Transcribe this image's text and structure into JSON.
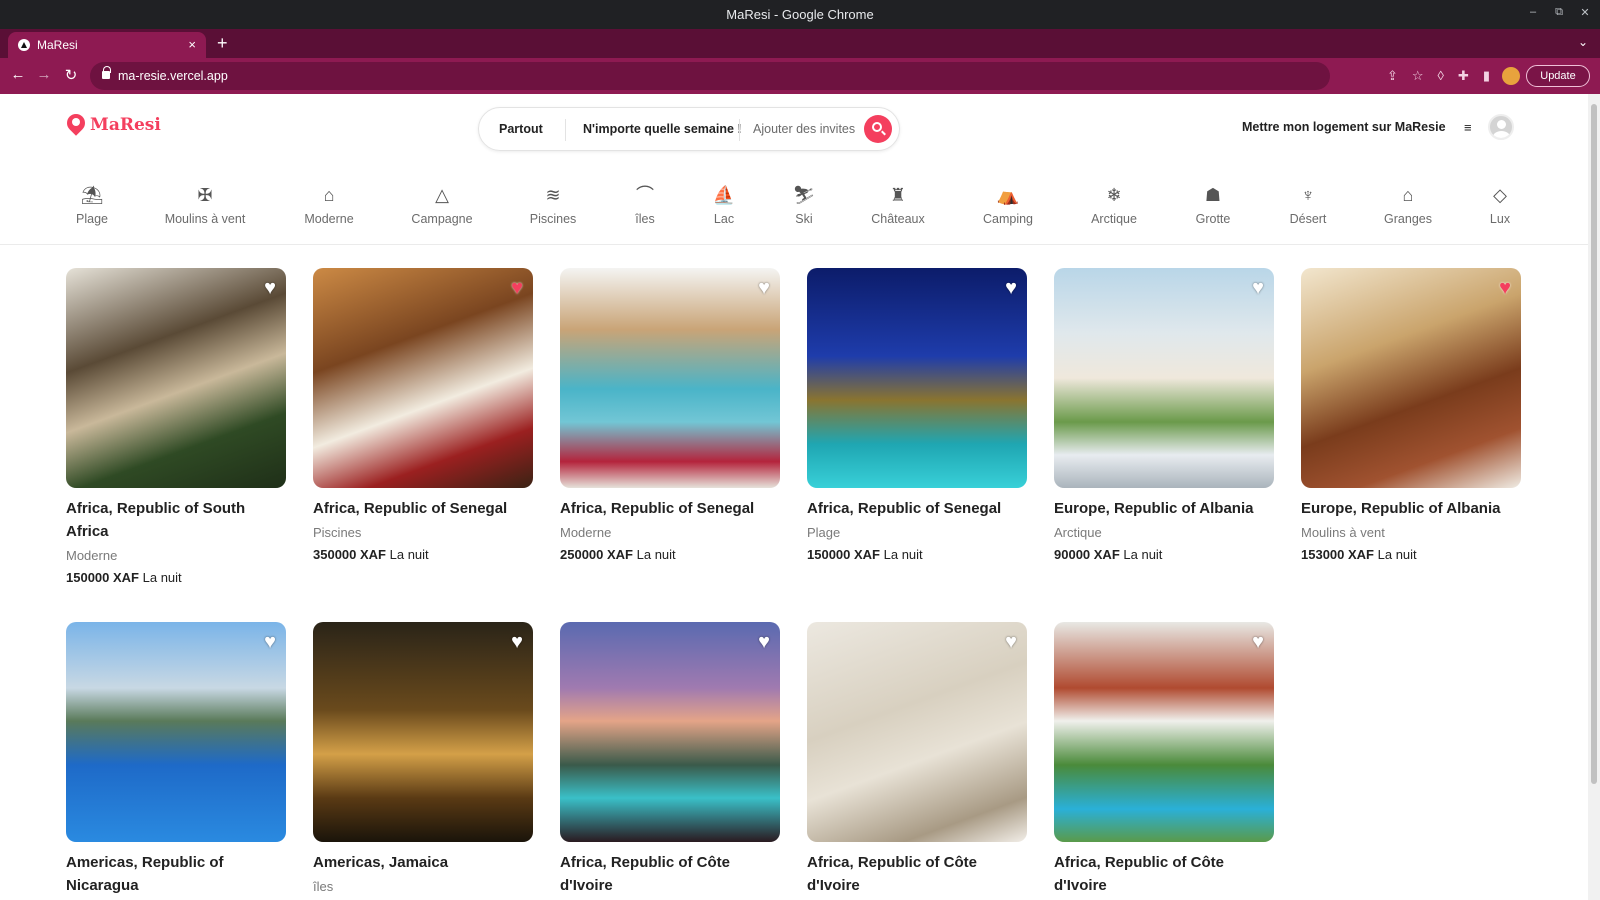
{
  "window": {
    "title": "MaResi - Google Chrome",
    "controls": [
      "–",
      "⧉",
      "✕"
    ]
  },
  "browser": {
    "tab_title": "MaResi",
    "tab_close": "×",
    "new_tab": "+",
    "tab_menu": "⌄",
    "url": "ma-resie.vercel.app",
    "update_label": "Update",
    "nav": {
      "back": "←",
      "forward": "→",
      "reload": "↻"
    },
    "icons": {
      "share": "⇪",
      "star": "☆",
      "drop": "◊",
      "puzzle": "✚",
      "panel": "▮"
    }
  },
  "header": {
    "brand": "MaResi",
    "search": {
      "where": "Partout",
      "when": "N'importe quelle semaine !",
      "who": "Ajouter des invites"
    },
    "host_link": "Mettre mon logement sur MaResie",
    "menu_icon": "≡"
  },
  "categories": [
    {
      "label": "Plage",
      "icon": "⛱"
    },
    {
      "label": "Moulins à vent",
      "icon": "✠"
    },
    {
      "label": "Moderne",
      "icon": "⌂"
    },
    {
      "label": "Campagne",
      "icon": "△"
    },
    {
      "label": "Piscines",
      "icon": "≋"
    },
    {
      "label": "îles",
      "icon": "⌒"
    },
    {
      "label": "Lac",
      "icon": "⛵"
    },
    {
      "label": "Ski",
      "icon": "⛷"
    },
    {
      "label": "Châteaux",
      "icon": "♜"
    },
    {
      "label": "Camping",
      "icon": "⛺"
    },
    {
      "label": "Arctique",
      "icon": "❄"
    },
    {
      "label": "Grotte",
      "icon": "☗"
    },
    {
      "label": "Désert",
      "icon": "♆"
    },
    {
      "label": "Granges",
      "icon": "⌂"
    },
    {
      "label": "Lux",
      "icon": "◇"
    }
  ],
  "listings": [
    {
      "location": "Africa, Republic of South Africa",
      "category": "Moderne",
      "price": "150000 XAF",
      "per": "La nuit",
      "favorite": false
    },
    {
      "location": "Africa, Republic of Senegal",
      "category": "Piscines",
      "price": "350000 XAF",
      "per": "La nuit",
      "favorite": true
    },
    {
      "location": "Africa, Republic of Senegal",
      "category": "Moderne",
      "price": "250000 XAF",
      "per": "La nuit",
      "favorite": false
    },
    {
      "location": "Africa, Republic of Senegal",
      "category": "Plage",
      "price": "150000 XAF",
      "per": "La nuit",
      "favorite": false
    },
    {
      "location": "Europe, Republic of Albania",
      "category": "Arctique",
      "price": "90000 XAF",
      "per": "La nuit",
      "favorite": false
    },
    {
      "location": "Europe, Republic of Albania",
      "category": "Moulins à vent",
      "price": "153000 XAF",
      "per": "La nuit",
      "favorite": true
    },
    {
      "location": "Americas, Republic of Nicaragua",
      "category": "",
      "price": "",
      "per": "",
      "favorite": false
    },
    {
      "location": "Americas, Jamaica",
      "category": "îles",
      "price": "",
      "per": "",
      "favorite": false
    },
    {
      "location": "Africa, Republic of Côte d'Ivoire",
      "category": "",
      "price": "",
      "per": "",
      "favorite": false
    },
    {
      "location": "Africa, Republic of Côte d'Ivoire",
      "category": "",
      "price": "",
      "per": "",
      "favorite": false
    },
    {
      "location": "Africa, Republic of Côte d'Ivoire",
      "category": "",
      "price": "",
      "per": "",
      "favorite": false
    }
  ],
  "colors": {
    "brand": "#f43f5e",
    "tab_strip": "#5a0f36",
    "toolbar": "#8e1a52"
  }
}
